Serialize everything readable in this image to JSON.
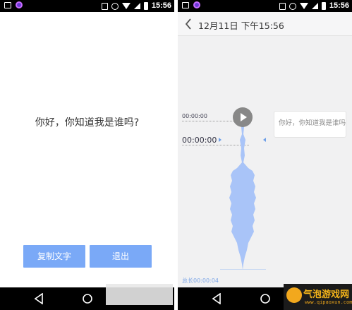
{
  "left_screen": {
    "status_time": "15:56",
    "question_text": "你好，你知道我是谁吗?",
    "copy_button_label": "复制文字",
    "exit_button_label": "退出"
  },
  "right_screen": {
    "status_time": "15:56",
    "header_title": "12月11日 下午15:56",
    "track_time_small": "00:00:00",
    "track_time_large": "00:00:00",
    "transcript_bubble": "你好，你知道我是谁吗",
    "total_duration": "总长00:00:04"
  },
  "watermark": {
    "title": "气泡游戏网",
    "subtitle": "www.qipaoxun.com"
  },
  "colors": {
    "accent": "#7aa9f7",
    "waveform": "#a9c4f8",
    "statusbar": "#000000"
  },
  "icons": [
    "image-icon",
    "camera-icon",
    "vibrate-icon",
    "alarm-icon",
    "wifi-icon",
    "signal-icon",
    "battery-icon",
    "back-icon",
    "home-icon",
    "recents-icon",
    "play-icon",
    "chevron-left-icon"
  ]
}
